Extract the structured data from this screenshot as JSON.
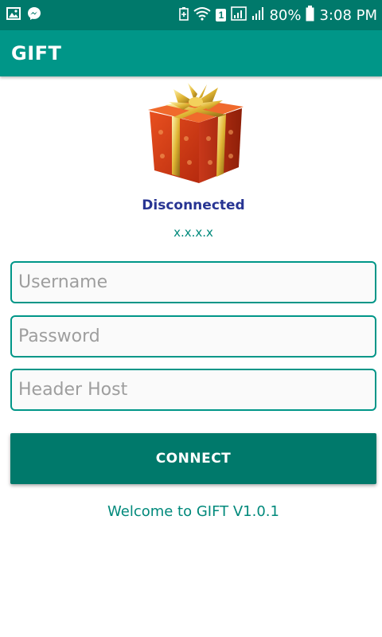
{
  "status_bar": {
    "battery": "80%",
    "time": "3:08 PM",
    "sim_badge": "1",
    "icons": [
      "image-icon",
      "messenger-icon",
      "battery-saver-icon",
      "wifi-icon",
      "sim-icon",
      "signal-icon",
      "signal-icon",
      "battery-icon"
    ]
  },
  "app_bar": {
    "title": "GIFT"
  },
  "main": {
    "logo": "gift-box-icon",
    "status": "Disconnected",
    "ip": "x.x.x.x",
    "username": {
      "placeholder": "Username",
      "value": ""
    },
    "password": {
      "placeholder": "Password",
      "value": ""
    },
    "header_host": {
      "placeholder": "Header Host",
      "value": ""
    },
    "connect_label": "CONNECT",
    "welcome": "Welcome to GIFT V1.0.1"
  },
  "colors": {
    "status_bar": "#00796b",
    "app_bar": "#009688",
    "status_text": "#283593",
    "accent": "#00897b",
    "button": "#00796b"
  }
}
